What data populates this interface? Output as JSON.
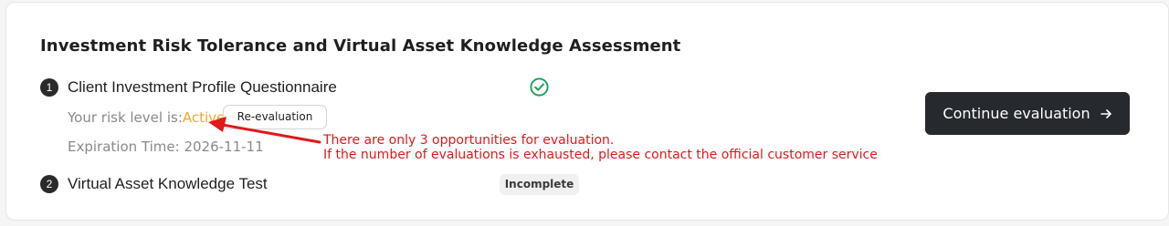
{
  "card": {
    "title": "Investment Risk Tolerance and Virtual Asset Knowledge Assessment"
  },
  "steps": [
    {
      "number": "1",
      "label": "Client Investment Profile Questionnaire",
      "status_icon": "check-circle-icon",
      "risk_prefix": "Your risk level is:",
      "risk_level": "Active",
      "reevaluate_label": "Re-evaluation",
      "expiry_prefix": "Expiration Time: ",
      "expiry_date": "2026-11-11"
    },
    {
      "number": "2",
      "label": "Virtual Asset Knowledge Test",
      "status": "Incomplete"
    }
  ],
  "annotation": {
    "line1": "There are only 3 opportunities for evaluation.",
    "line2": "If the number of evaluations is exhausted, please contact the official customer service"
  },
  "actions": {
    "continue_label": "Continue evaluation",
    "continue_icon": "arrow-right-icon"
  },
  "colors": {
    "accent_active": "#f0a52c",
    "success_green": "#1aa35c",
    "annotation_red": "#e01919",
    "button_dark": "#26292e"
  }
}
